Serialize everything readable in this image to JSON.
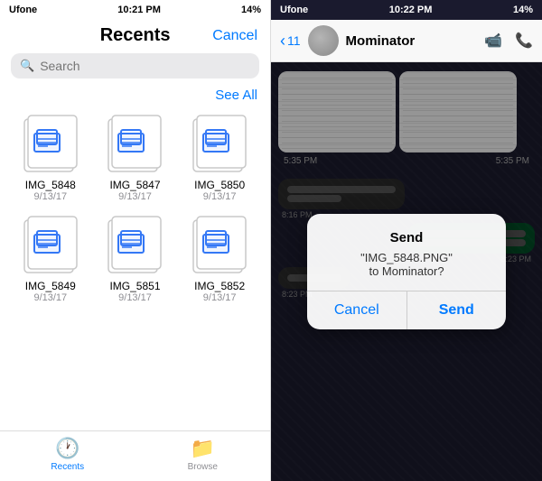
{
  "left": {
    "status": {
      "carrier": "Ufone",
      "time": "10:21 PM",
      "battery": "14%"
    },
    "header": {
      "title": "Recents",
      "cancel": "Cancel"
    },
    "search": {
      "placeholder": "Search"
    },
    "seeAll": "See All",
    "files": [
      {
        "name": "IMG_5848",
        "date": "9/13/17"
      },
      {
        "name": "IMG_5847",
        "date": "9/13/17"
      },
      {
        "name": "IMG_5850",
        "date": "9/13/17"
      },
      {
        "name": "IMG_5849",
        "date": "9/13/17"
      },
      {
        "name": "IMG_5851",
        "date": "9/13/17"
      },
      {
        "name": "IMG_5852",
        "date": "9/13/17"
      }
    ],
    "tabs": [
      {
        "id": "recents",
        "label": "Recents",
        "active": true
      },
      {
        "id": "browse",
        "label": "Browse",
        "active": false
      }
    ]
  },
  "right": {
    "status": {
      "carrier": "Ufone",
      "time": "10:22 PM",
      "battery": "14%"
    },
    "header": {
      "backCount": "11",
      "contactName": "Mominator"
    },
    "timestamps": {
      "t1": "5:35 PM",
      "t2": "5:35 PM",
      "t3": "8:16 PM",
      "t4": "8:23 PM",
      "t5": "8:23 PM"
    },
    "dialog": {
      "line1": "Send",
      "line2": "\"IMG_5848.PNG\"",
      "line3": "to Mominator?",
      "cancelLabel": "Cancel",
      "sendLabel": "Send"
    }
  }
}
